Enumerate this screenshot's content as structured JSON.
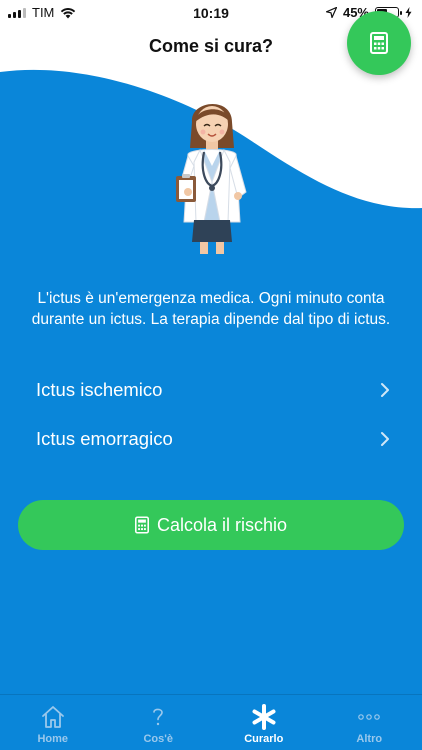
{
  "status_bar": {
    "carrier": "TIM",
    "time": "10:19",
    "battery_percent": "45%",
    "battery_level": 0.45
  },
  "header": {
    "title": "Come si cura?",
    "fab_icon": "calculator-icon"
  },
  "colors": {
    "primary_blue": "#0a86d9",
    "accent_green": "#34c85a",
    "white": "#ffffff"
  },
  "content": {
    "intro": "L'ictus è un'emergenza medica. Ogni minuto conta durante un ictus. La terapia dipende dal tipo di ictus.",
    "items": [
      {
        "label": "Ictus ischemico",
        "icon": "chevron-right-icon"
      },
      {
        "label": "Ictus emorragico",
        "icon": "chevron-right-icon"
      }
    ],
    "cta": {
      "label": "Calcola il rischio",
      "icon": "calculator-icon"
    }
  },
  "tabbar": {
    "tabs": [
      {
        "label": "Home",
        "icon": "home-icon",
        "active": false
      },
      {
        "label": "Cos'è",
        "icon": "question-icon",
        "active": false
      },
      {
        "label": "Curarlo",
        "icon": "asterisk-icon",
        "active": true
      },
      {
        "label": "Altro",
        "icon": "more-icon",
        "active": false
      }
    ]
  }
}
